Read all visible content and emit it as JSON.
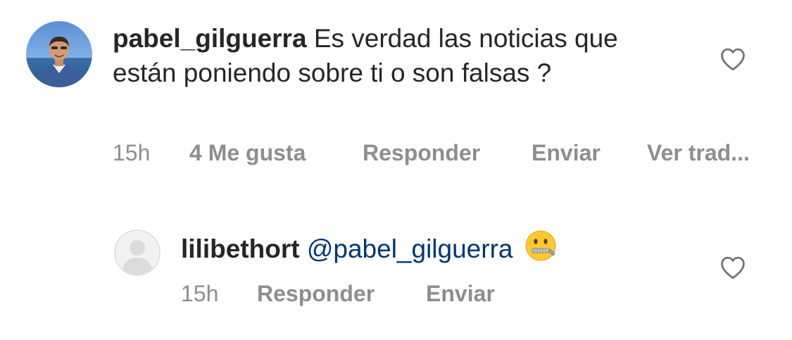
{
  "comment": {
    "username": "pabel_gilguerra",
    "text": "Es verdad las noticias que están poniendo sobre ti o son falsas ?",
    "time": "15h",
    "likes": "4 Me gusta",
    "reply_label": "Responder",
    "send_label": "Enviar",
    "translate_label": "Ver trad..."
  },
  "reply": {
    "username": "lilibethort",
    "mention": "@pabel_gilguerra",
    "emoji": "zipper-mouth-face",
    "time": "15h",
    "reply_label": "Responder",
    "send_label": "Enviar"
  },
  "colors": {
    "text": "#262626",
    "meta": "#8e8e8e",
    "mention": "#00376b"
  },
  "icons": [
    "heart-outline-icon",
    "default-avatar-icon",
    "zipper-mouth-face-emoji"
  ]
}
